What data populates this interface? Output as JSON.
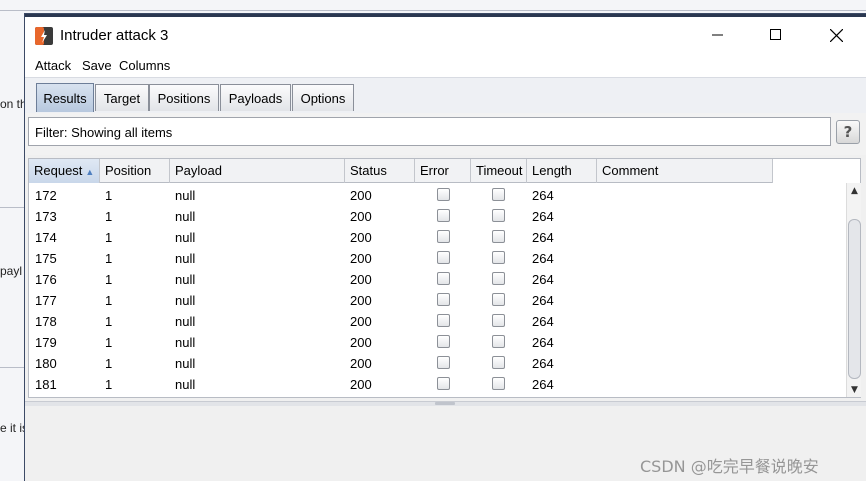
{
  "background": {
    "fragments": [
      "on th",
      "payl",
      "e it is"
    ]
  },
  "window": {
    "title": "Intruder attack 3",
    "icon": "burp-intruder-icon"
  },
  "menu": [
    "Attack",
    "Save",
    "Columns"
  ],
  "tabs": [
    {
      "label": "Results",
      "active": true
    },
    {
      "label": "Target",
      "active": false
    },
    {
      "label": "Positions",
      "active": false
    },
    {
      "label": "Payloads",
      "active": false
    },
    {
      "label": "Options",
      "active": false
    }
  ],
  "filter": {
    "text": "Filter: Showing all items",
    "help": "?"
  },
  "table": {
    "columns": [
      "Request",
      "Position",
      "Payload",
      "Status",
      "Error",
      "Timeout",
      "Length",
      "Comment"
    ],
    "sorted_column": "Request",
    "sort_direction": "ascending",
    "rows": [
      {
        "request": "172",
        "position": "1",
        "payload": "null",
        "status": "200",
        "error": false,
        "timeout": false,
        "length": "264",
        "comment": ""
      },
      {
        "request": "173",
        "position": "1",
        "payload": "null",
        "status": "200",
        "error": false,
        "timeout": false,
        "length": "264",
        "comment": ""
      },
      {
        "request": "174",
        "position": "1",
        "payload": "null",
        "status": "200",
        "error": false,
        "timeout": false,
        "length": "264",
        "comment": ""
      },
      {
        "request": "175",
        "position": "1",
        "payload": "null",
        "status": "200",
        "error": false,
        "timeout": false,
        "length": "264",
        "comment": ""
      },
      {
        "request": "176",
        "position": "1",
        "payload": "null",
        "status": "200",
        "error": false,
        "timeout": false,
        "length": "264",
        "comment": ""
      },
      {
        "request": "177",
        "position": "1",
        "payload": "null",
        "status": "200",
        "error": false,
        "timeout": false,
        "length": "264",
        "comment": ""
      },
      {
        "request": "178",
        "position": "1",
        "payload": "null",
        "status": "200",
        "error": false,
        "timeout": false,
        "length": "264",
        "comment": ""
      },
      {
        "request": "179",
        "position": "1",
        "payload": "null",
        "status": "200",
        "error": false,
        "timeout": false,
        "length": "264",
        "comment": ""
      },
      {
        "request": "180",
        "position": "1",
        "payload": "null",
        "status": "200",
        "error": false,
        "timeout": false,
        "length": "264",
        "comment": ""
      },
      {
        "request": "181",
        "position": "1",
        "payload": "null",
        "status": "200",
        "error": false,
        "timeout": false,
        "length": "264",
        "comment": ""
      }
    ]
  },
  "watermark": "CSDN @吃完早餐说晚安",
  "colors": {
    "active_tab": "#b7c8de",
    "window_border": "#3c4a66",
    "icon_orange": "#e8672c"
  }
}
